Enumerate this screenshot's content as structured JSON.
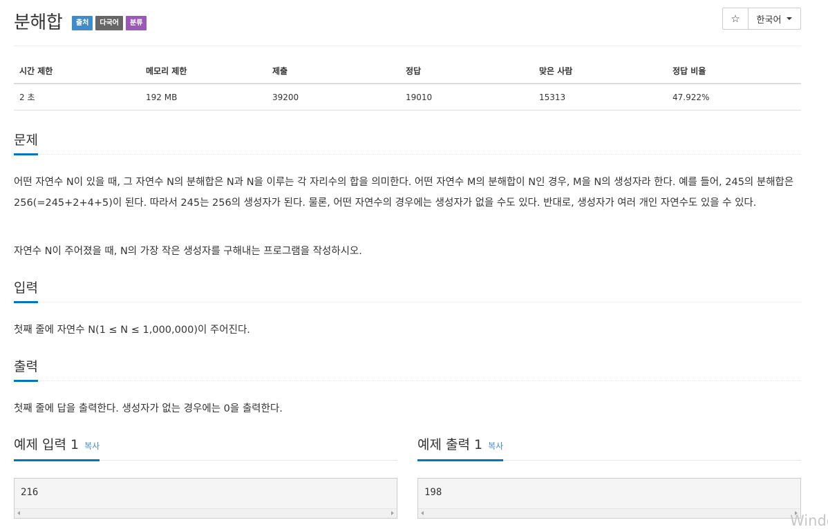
{
  "problem": {
    "title": "분해합",
    "labels": [
      {
        "text": "출처",
        "color": "#428bca"
      },
      {
        "text": "다국어",
        "color": "#666666"
      },
      {
        "text": "분류",
        "color": "#9b59b6"
      }
    ],
    "star_icon": "☆",
    "language": "한국어"
  },
  "info_table": {
    "headers": [
      "시간 제한",
      "메모리 제한",
      "제출",
      "정답",
      "맞은 사람",
      "정답 비율"
    ],
    "values": [
      "2 초",
      "192 MB",
      "39200",
      "19010",
      "15313",
      "47.922%"
    ]
  },
  "sections": {
    "description": {
      "title": "문제",
      "paragraphs": [
        "어떤 자연수 N이 있을 때, 그 자연수 N의 분해합은 N과 N을 이루는 각 자리수의 합을 의미한다. 어떤 자연수 M의 분해합이 N인 경우, M을 N의 생성자라 한다. 예를 들어, 245의 분해합은 256(=245+2+4+5)이 된다. 따라서 245는 256의 생성자가 된다. 물론, 어떤 자연수의 경우에는 생성자가 없을 수도 있다. 반대로, 생성자가 여러 개인 자연수도 있을 수 있다.",
        "자연수 N이 주어졌을 때, N의 가장 작은 생성자를 구해내는 프로그램을 작성하시오."
      ]
    },
    "input": {
      "title": "입력",
      "text": "첫째 줄에 자연수 N(1 ≤ N ≤ 1,000,000)이 주어진다."
    },
    "output": {
      "title": "출력",
      "text": "첫째 줄에 답을 출력한다. 생성자가 없는 경우에는 0을 출력한다."
    }
  },
  "samples": {
    "input": {
      "title": "예제 입력 1",
      "copy_label": "복사",
      "value": "216"
    },
    "output": {
      "title": "예제 출력 1",
      "copy_label": "복사",
      "value": "198"
    }
  },
  "watermark": "Windo",
  "colors": {
    "accent": "#0076c0",
    "link": "#428bca"
  }
}
